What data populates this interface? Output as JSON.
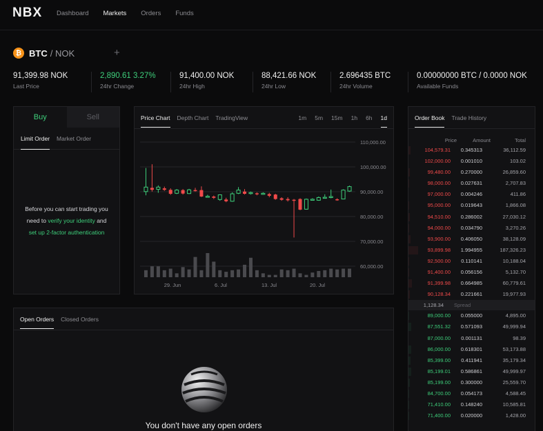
{
  "nav": {
    "logo": "NBX",
    "links": [
      "Dashboard",
      "Markets",
      "Orders",
      "Funds"
    ],
    "active": "Markets"
  },
  "pair": {
    "icon": "bitcoin-icon",
    "base": "BTC",
    "sep_quote": "/ NOK",
    "add": "+"
  },
  "stats": [
    {
      "value": "91,399.98 NOK",
      "label": "Last Price"
    },
    {
      "value": "2,890.61 3.27%",
      "label": "24hr Change",
      "positive": true
    },
    {
      "value": "91,400.00 NOK",
      "label": "24hr High"
    },
    {
      "value": "88,421.66 NOK",
      "label": "24hr Low"
    },
    {
      "value": "2.696435 BTC",
      "label": "24hr Volume"
    },
    {
      "value": "0.00000000 BTC / 0.0000 NOK",
      "label": "Available Funds"
    }
  ],
  "trade": {
    "buy": "Buy",
    "sell": "Sell",
    "order_types": [
      "Limit Order",
      "Market Order"
    ],
    "msg_line1": "Before you can start trading you",
    "msg_line2_prefix": "need to ",
    "msg_verify": "verify your identity",
    "msg_line2_suffix": " and",
    "msg_2fa": "set up 2-factor authentication"
  },
  "chart_tabs": [
    "Price Chart",
    "Depth Chart",
    "TradingView"
  ],
  "timeframes": [
    "1m",
    "5m",
    "15m",
    "1h",
    "6h",
    "1d"
  ],
  "active_timeframe": "1d",
  "chart_data": {
    "type": "candlestick",
    "y_ticks": [
      "110,000.00",
      "100,000.00",
      "90,000.00",
      "80,000.00",
      "70,000.00",
      "60,000.00"
    ],
    "ylim": [
      60000,
      110000
    ],
    "x_ticks": [
      "29. Jun",
      "6. Jul",
      "13. Jul",
      "20. Jul"
    ],
    "candles": [
      {
        "o": 89500,
        "c": 91300,
        "h": 99000,
        "l": 88000
      },
      {
        "o": 91000,
        "c": 90200,
        "h": 100500,
        "l": 89500
      },
      {
        "o": 90400,
        "c": 91300,
        "h": 92000,
        "l": 89000
      },
      {
        "o": 90800,
        "c": 90200,
        "h": 91500,
        "l": 89800
      },
      {
        "o": 90200,
        "c": 88600,
        "h": 90800,
        "l": 88200
      },
      {
        "o": 88800,
        "c": 90100,
        "h": 90500,
        "l": 88500
      },
      {
        "o": 90100,
        "c": 88700,
        "h": 90500,
        "l": 88300
      },
      {
        "o": 88700,
        "c": 90200,
        "h": 90600,
        "l": 88500
      },
      {
        "o": 90100,
        "c": 89900,
        "h": 91000,
        "l": 89500
      },
      {
        "o": 90100,
        "c": 87500,
        "h": 91600,
        "l": 87300
      },
      {
        "o": 87600,
        "c": 87600,
        "h": 88200,
        "l": 87300
      },
      {
        "o": 87500,
        "c": 87000,
        "h": 87900,
        "l": 86500
      },
      {
        "o": 86300,
        "c": 88200,
        "h": 88400,
        "l": 85800
      },
      {
        "o": 86300,
        "c": 85600,
        "h": 87000,
        "l": 85200
      },
      {
        "o": 85600,
        "c": 88600,
        "h": 89200,
        "l": 85400
      },
      {
        "o": 88800,
        "c": 90100,
        "h": 91300,
        "l": 88500
      },
      {
        "o": 89500,
        "c": 88600,
        "h": 90500,
        "l": 88300
      },
      {
        "o": 88700,
        "c": 89100,
        "h": 89500,
        "l": 88300
      },
      {
        "o": 88800,
        "c": 88400,
        "h": 89200,
        "l": 88000
      },
      {
        "o": 88600,
        "c": 88800,
        "h": 89200,
        "l": 88200
      },
      {
        "o": 88500,
        "c": 87800,
        "h": 89000,
        "l": 87200
      },
      {
        "o": 88300,
        "c": 86500,
        "h": 88600,
        "l": 86200
      },
      {
        "o": 86800,
        "c": 86200,
        "h": 87200,
        "l": 85800
      },
      {
        "o": 86500,
        "c": 86000,
        "h": 87200,
        "l": 85500
      },
      {
        "o": 86200,
        "c": 85900,
        "h": 86500,
        "l": 71000
      },
      {
        "o": 86500,
        "c": 82200,
        "h": 86800,
        "l": 82000
      },
      {
        "o": 82400,
        "c": 86400,
        "h": 86700,
        "l": 82200
      },
      {
        "o": 86400,
        "c": 86400,
        "h": 86800,
        "l": 86000
      },
      {
        "o": 86000,
        "c": 87100,
        "h": 87500,
        "l": 85800
      },
      {
        "o": 87200,
        "c": 87200,
        "h": 88400,
        "l": 86800
      },
      {
        "o": 87100,
        "c": 87500,
        "h": 90300,
        "l": 86800
      },
      {
        "o": 86400,
        "c": 86200,
        "h": 86800,
        "l": 85800
      },
      {
        "o": 86500,
        "c": 90100,
        "h": 90400,
        "l": 86400
      },
      {
        "o": 89700,
        "c": 91500,
        "h": 91900,
        "l": 89400
      }
    ],
    "volumes": [
      0.9,
      1.4,
      1.4,
      0.9,
      1.1,
      0.5,
      1.3,
      1.0,
      2.6,
      0.9,
      3.1,
      2.0,
      0.9,
      0.7,
      0.9,
      1.0,
      1.6,
      2.5,
      0.9,
      0.5,
      0.3,
      0.3,
      1.0,
      0.9,
      1.1,
      0.5,
      0.3,
      0.6,
      0.8,
      0.9,
      1.1,
      1.0,
      1.1,
      1.1
    ]
  },
  "orderbook": {
    "tabs": [
      "Order Book",
      "Trade History"
    ],
    "columns": [
      "Price",
      "Amount",
      "Total"
    ],
    "asks": [
      [
        "104,579.31",
        "0.345313",
        "36,112.59",
        0.19
      ],
      [
        "102,000.00",
        "0.001010",
        "103.02",
        0.0
      ],
      [
        "99,480.00",
        "0.270000",
        "26,859.60",
        0.14
      ],
      [
        "98,000.00",
        "0.027631",
        "2,707.83",
        0.02
      ],
      [
        "97,000.00",
        "0.004246",
        "411.86",
        0.0
      ],
      [
        "95,000.00",
        "0.019643",
        "1,866.08",
        0.01
      ],
      [
        "94,510.00",
        "0.286002",
        "27,030.12",
        0.15
      ],
      [
        "94,000.00",
        "0.034790",
        "3,270.26",
        0.02
      ],
      [
        "93,900.00",
        "0.406050",
        "38,128.09",
        0.2
      ],
      [
        "93,899.98",
        "1.994955",
        "187,326.23",
        1.0
      ],
      [
        "92,500.00",
        "0.110141",
        "10,188.04",
        0.06
      ],
      [
        "91,400.00",
        "0.056156",
        "5,132.70",
        0.03
      ],
      [
        "91,399.98",
        "0.664985",
        "60,779.61",
        0.33
      ],
      [
        "90,128.34",
        "0.221661",
        "19,977.93",
        0.11
      ]
    ],
    "spread_value": "1,128.34",
    "spread_label": "Spread",
    "bids": [
      [
        "89,000.00",
        "0.055000",
        "4,895.00",
        0.03
      ],
      [
        "87,551.32",
        "0.571093",
        "49,999.94",
        0.27
      ],
      [
        "87,000.00",
        "0.001131",
        "98.39",
        0.0
      ],
      [
        "86,000.00",
        "0.618301",
        "53,173.88",
        0.29
      ],
      [
        "85,399.00",
        "0.411941",
        "35,179.34",
        0.19
      ],
      [
        "85,199.01",
        "0.586861",
        "49,999.97",
        0.27
      ],
      [
        "85,199.00",
        "0.300000",
        "25,559.70",
        0.14
      ],
      [
        "84,700.00",
        "0.054173",
        "4,588.45",
        0.03
      ],
      [
        "71,410.00",
        "0.148240",
        "10,585.81",
        0.06
      ],
      [
        "71,400.00",
        "0.020000",
        "1,428.00",
        0.01
      ]
    ]
  },
  "orders": {
    "tabs": [
      "Open Orders",
      "Closed Orders"
    ],
    "empty_text": "You don't have any open orders",
    "empty_icon": "sphere-illustration-icon"
  },
  "colors": {
    "up": "#3ecf7b",
    "down": "#f04a4a",
    "bg": "#0b0b0c",
    "panel": "#121214"
  }
}
